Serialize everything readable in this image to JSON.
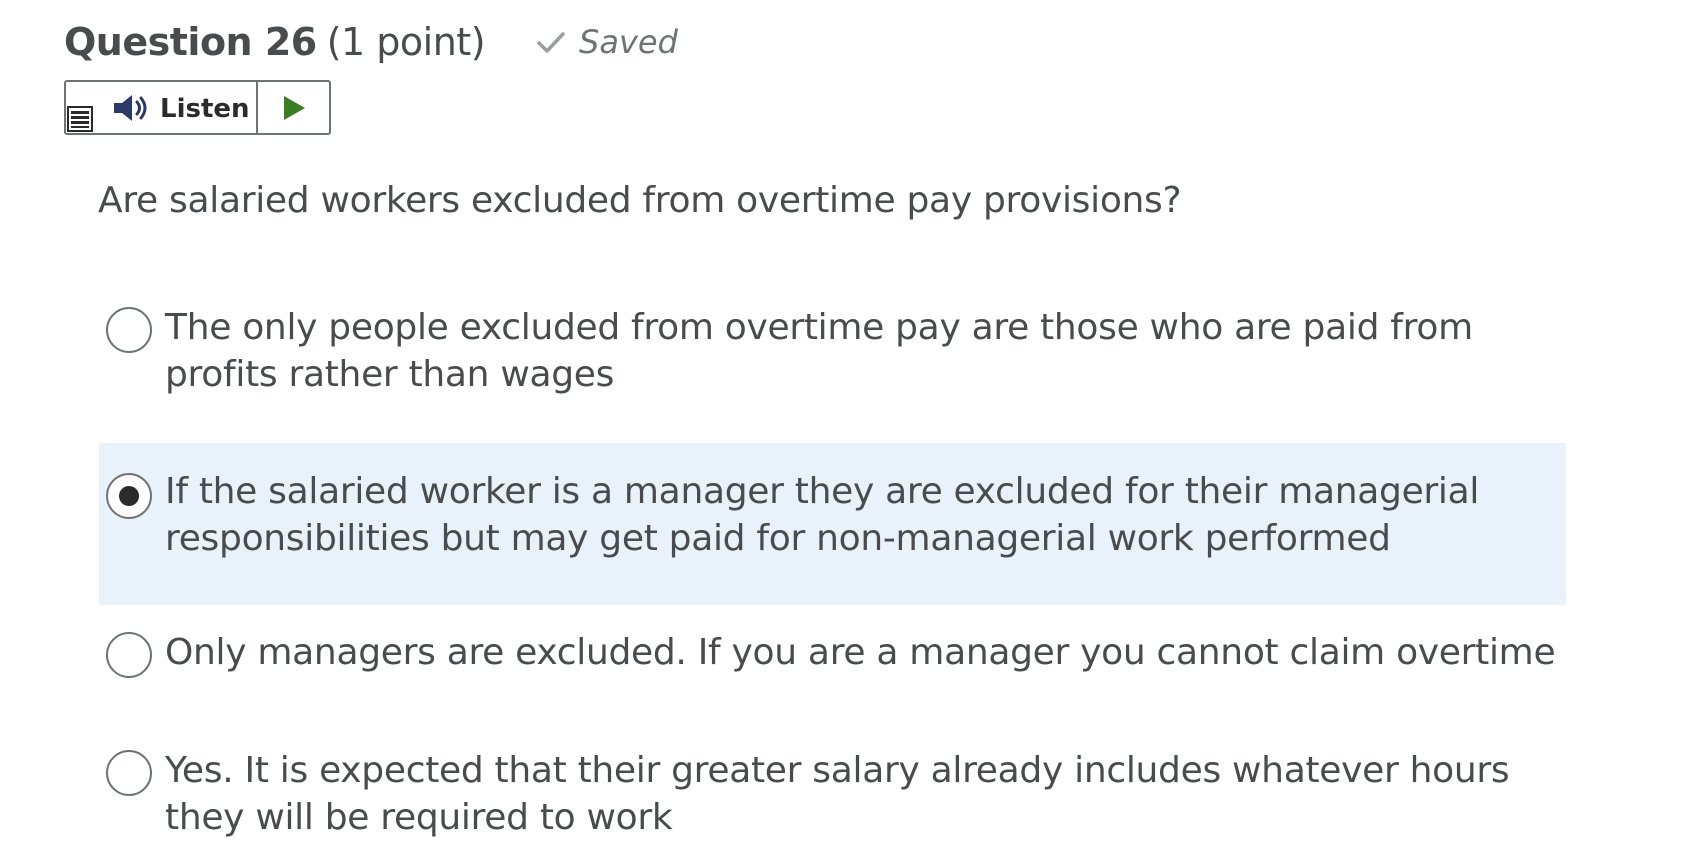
{
  "question": {
    "title": "Question 26",
    "points": "(1 point)",
    "status": "Saved",
    "status_icon": "check-icon"
  },
  "listen": {
    "label": "Listen",
    "menu_icon": "menu-icon",
    "speaker_icon": "speaker-icon",
    "play_icon": "play-icon"
  },
  "prompt": "Are salaried workers excluded from overtime pay provisions?",
  "options": [
    {
      "text": "The only people excluded from overtime pay are those who are paid from profits rather than wages",
      "selected": false
    },
    {
      "text": "If the salaried worker is a manager they are excluded for their managerial responsibilities but may get paid for non-managerial work performed",
      "selected": true
    },
    {
      "text": "Only managers are excluded.  If you are a manager you cannot claim overtime",
      "selected": false
    },
    {
      "text": "Yes.  It is expected that their greater salary already includes whatever hours they will be required to work",
      "selected": false
    }
  ],
  "colors": {
    "text": "#494c4e",
    "selected_background": "#e9f1fb",
    "play_green": "#3b7d23",
    "border": "#6e7376"
  }
}
